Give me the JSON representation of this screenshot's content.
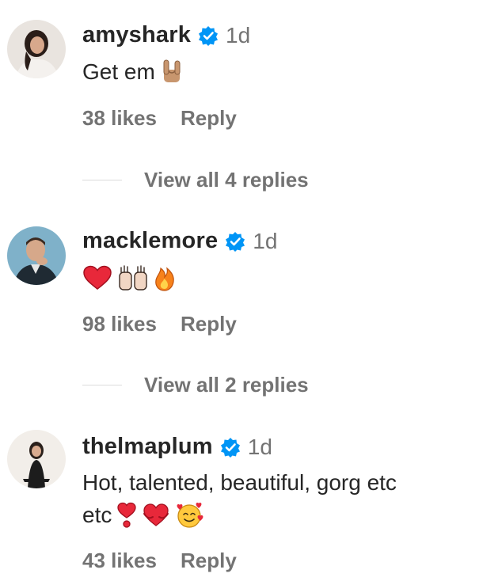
{
  "comments": [
    {
      "username": "amyshark",
      "time": "1d",
      "text": "Get em",
      "emojis": [
        "sign-of-horns"
      ],
      "likes": "38 likes",
      "reply": "Reply",
      "view_replies": "View all 4 replies"
    },
    {
      "username": "macklemore",
      "time": "1d",
      "text": "",
      "emojis": [
        "red-heart",
        "raising-hands",
        "fire"
      ],
      "likes": "98 likes",
      "reply": "Reply",
      "view_replies": "View all 2 replies"
    },
    {
      "username": "thelmaplum",
      "time": "1d",
      "text_line1": "Hot, talented, beautiful, gorg etc",
      "text_line2": "etc",
      "emojis": [
        "heart-exclamation",
        "heart-with-arms",
        "smiling-face-with-hearts"
      ],
      "likes": "43 likes",
      "reply": "Reply"
    }
  ],
  "colors": {
    "text": "#262626",
    "secondary": "#737373",
    "verified": "#0095f6",
    "divider": "#dbdbdb"
  }
}
